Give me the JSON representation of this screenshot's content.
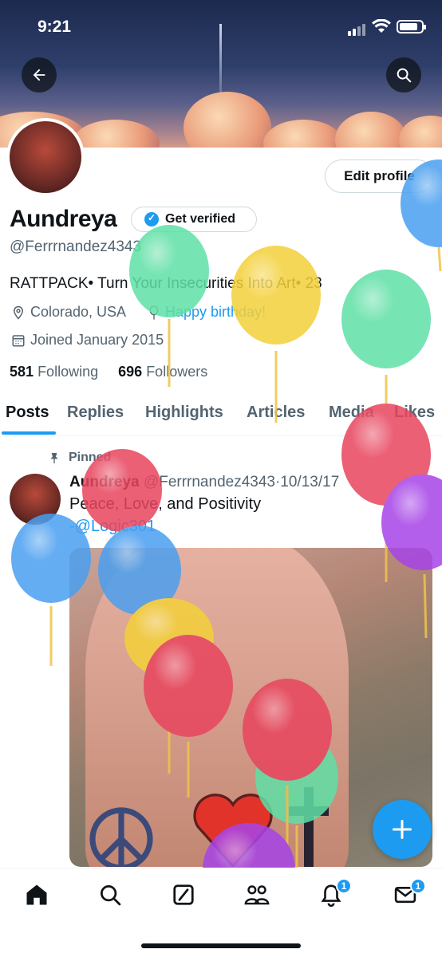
{
  "status_bar": {
    "time": "9:21"
  },
  "profile": {
    "name": "Aundreya",
    "get_verified_label": "Get verified",
    "handle": "@Ferrrnandez4343",
    "bio": "RATTPACK• Turn Your Insecurities Into Art• 23",
    "location": "Colorado, USA",
    "birthday_text": "Happy birthday!",
    "joined": "Joined January 2015",
    "following_count": "581",
    "following_label": "Following",
    "followers_count": "696",
    "followers_label": "Followers",
    "edit_profile_label": "Edit profile"
  },
  "tabs": [
    {
      "label": "Posts"
    },
    {
      "label": "Replies"
    },
    {
      "label": "Highlights"
    },
    {
      "label": "Articles"
    },
    {
      "label": "Media"
    },
    {
      "label": "Likes"
    }
  ],
  "pinned_post": {
    "pinned_label": "Pinned",
    "author_name": "Aundreya",
    "author_handle": "@Ferrrnandez4343",
    "separator": "·",
    "date": "10/13/17",
    "text": "Peace, Love, and Positivity",
    "mention": "-@Logic301"
  },
  "bottom_nav": {
    "notifications_badge": "1",
    "messages_badge": "1"
  },
  "colors": {
    "accent": "#1d9bf0",
    "text_primary": "#0f1419",
    "text_secondary": "#536471",
    "balloon_colors": [
      "#4a9ff0",
      "#5fe0a6",
      "#f4d13a",
      "#e8455e",
      "#a744e8"
    ]
  },
  "icons": [
    "back-arrow-icon",
    "search-icon",
    "verified-badge-icon",
    "location-icon",
    "balloon-icon",
    "calendar-icon",
    "pin-icon",
    "plus-icon",
    "home-icon",
    "explore-icon",
    "grok-icon",
    "communities-icon",
    "notifications-icon",
    "messages-icon"
  ]
}
